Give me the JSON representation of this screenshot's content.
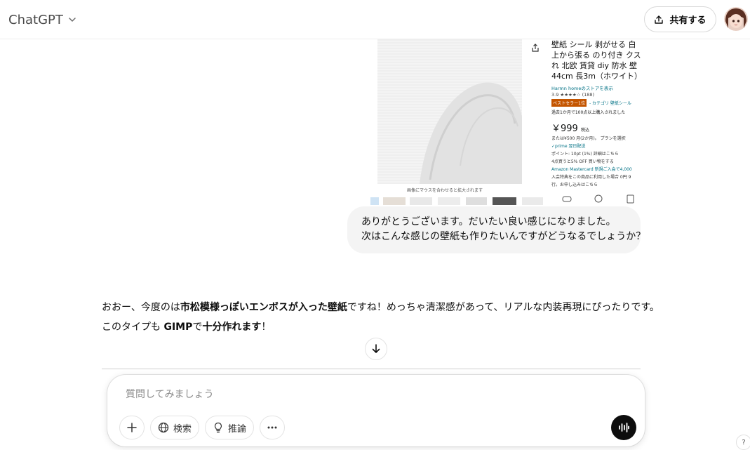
{
  "header": {
    "model_name": "ChatGPT",
    "share_label": "共有する"
  },
  "attachment": {
    "title": "壁紙 シール 剥がせる 白\n上から張る のり付き クス\nれ 北欧 賃貸 diy 防水 壁\n44cm 長3m（ホワイト）",
    "store": "Harmn homeのストアを表示",
    "rating": "3.9 ★★★★☆ (188)",
    "bestseller": "ベストセラー1位",
    "category": "- カテゴリ 壁紙シール",
    "sold": "過去1か月で100点以上購入されました",
    "price": "￥999",
    "price_tax": "税込",
    "installment": "または¥500 月(2か月)。 プランを選択",
    "prime": "✓prime 翌日配送",
    "points": "ポイント: 10pt (1%) 詳細はこちら",
    "discount": "4点買うと5% OFF 買い物をする",
    "card_offer_1": "Amazon Mastercard 新規ご入会で4,000",
    "card_offer_2": "入会特典をこの商品に利用した場合 0円 9",
    "card_offer_3": "行。お申し込みはこちら",
    "caption": "画像にマウスを合わせると拡大されます"
  },
  "user_message": {
    "lines": [
      "ありがとうございます。だいたい良い感じになりました。",
      "次はこんな感じの壁紙も作りたいんですがどうなるでしょうか？"
    ]
  },
  "assistant_message": {
    "line1_a": "おおー、今度のは",
    "line1_b": "市松模様っぽいエンボスが入った壁紙",
    "line1_c": "ですね！めっちゃ清潔感があって、リアルな内装再現にぴったりです。",
    "line2_a": "このタイプも ",
    "line2_b": "GIMP",
    "line2_c": "で",
    "line2_d": "十分作れます",
    "line2_e": "！"
  },
  "composer": {
    "placeholder": "質問してみましょう",
    "search_label": "検索",
    "reason_label": "推論"
  },
  "help": {
    "label": "?"
  },
  "icons": {
    "model": "chevron-down-icon",
    "share": "share-upload-icon",
    "scroll": "arrow-down-icon",
    "add": "plus-icon",
    "search": "globe-icon",
    "reason": "lightbulb-icon",
    "more": "more-dots-icon",
    "voice": "voice-waveform-icon"
  },
  "colors": {
    "user_bubble": "#f4f4f4",
    "voice_button": "#0d0d0d",
    "text": "#0d0d0d"
  }
}
